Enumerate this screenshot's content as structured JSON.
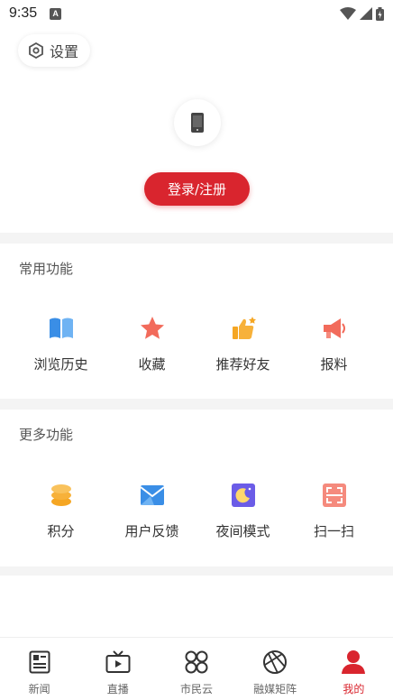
{
  "status": {
    "time": "9:35",
    "notif": "A"
  },
  "settings": {
    "label": "设置"
  },
  "login": {
    "label": "登录/注册"
  },
  "common": {
    "title": "常用功能",
    "items": [
      {
        "label": "浏览历史",
        "icon": "book-icon"
      },
      {
        "label": "收藏",
        "icon": "star-icon"
      },
      {
        "label": "推荐好友",
        "icon": "thumbs-up-icon"
      },
      {
        "label": "报料",
        "icon": "megaphone-icon"
      }
    ]
  },
  "more": {
    "title": "更多功能",
    "items": [
      {
        "label": "积分",
        "icon": "coins-icon"
      },
      {
        "label": "用户反馈",
        "icon": "mail-icon"
      },
      {
        "label": "夜间模式",
        "icon": "moon-icon"
      },
      {
        "label": "扫一扫",
        "icon": "scan-icon"
      }
    ]
  },
  "tabs": [
    {
      "label": "新闻",
      "icon": "newspaper-icon",
      "active": false
    },
    {
      "label": "直播",
      "icon": "tv-icon",
      "active": false
    },
    {
      "label": "市民云",
      "icon": "cloud-grid-icon",
      "active": false
    },
    {
      "label": "融媒矩阵",
      "icon": "matrix-icon",
      "active": false
    },
    {
      "label": "我的",
      "icon": "user-icon",
      "active": true
    }
  ],
  "colors": {
    "accent": "#d9252e",
    "blue": "#3a8ee6",
    "orange": "#f5a623",
    "purple": "#6b5ce7"
  }
}
